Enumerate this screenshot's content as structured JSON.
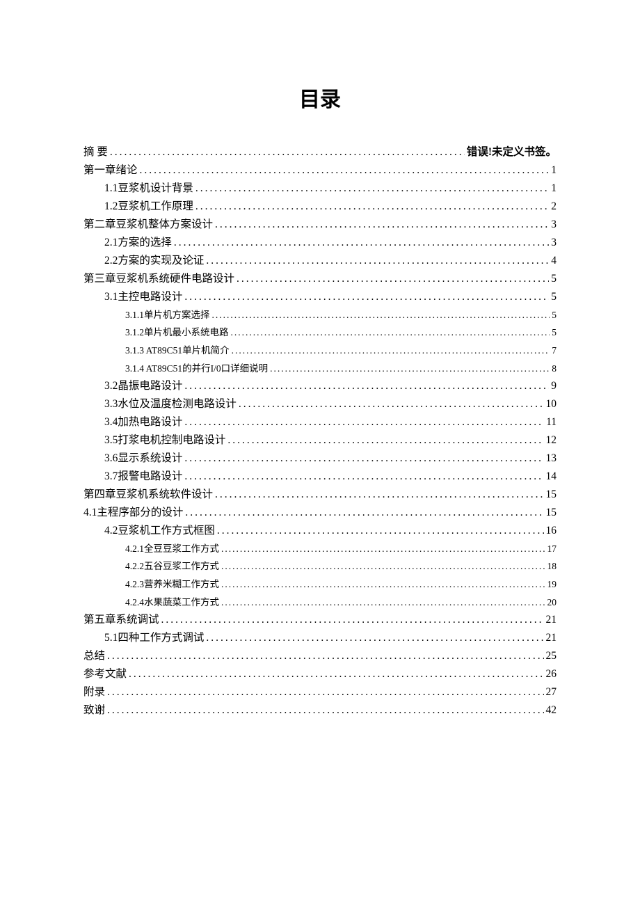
{
  "title": "目录",
  "entries": [
    {
      "label": "摘 要",
      "page": "错误!未定义书签。",
      "indent": 0,
      "size": "n",
      "errPage": true
    },
    {
      "label": "第一章绪论",
      "page": "1",
      "indent": 0,
      "size": "n"
    },
    {
      "label": "1.1豆浆机设计背景",
      "page": "1",
      "indent": 1,
      "size": "n"
    },
    {
      "label": "1.2豆浆机工作原理",
      "page": "2",
      "indent": 1,
      "size": "n"
    },
    {
      "label": "第二章豆浆机整体方案设计",
      "page": "3",
      "indent": 0,
      "size": "n"
    },
    {
      "label": "2.1方案的选择",
      "page": "3",
      "indent": 1,
      "size": "n"
    },
    {
      "label": "2.2方案的实现及论证",
      "page": "4",
      "indent": 1,
      "size": "n"
    },
    {
      "label": "第三章豆浆机系统硬件电路设计",
      "page": "5",
      "indent": 0,
      "size": "n"
    },
    {
      "label": "3.1主控电路设计",
      "page": "5",
      "indent": 1,
      "size": "n"
    },
    {
      "label": "3.1.1单片机方案选择",
      "page": "5",
      "indent": 2,
      "size": "s"
    },
    {
      "label": "3.1.2单片机最小系统电路",
      "page": "5",
      "indent": 2,
      "size": "s"
    },
    {
      "label": "3.1.3 AT89C51单片机简介",
      "page": "7",
      "indent": 2,
      "size": "s"
    },
    {
      "label": "3.1.4 AT89C51的并行I/0口详细说明",
      "page": "8",
      "indent": 2,
      "size": "s"
    },
    {
      "label": "3.2晶振电路设计",
      "page": "9",
      "indent": 1,
      "size": "n"
    },
    {
      "label": "3.3水位及温度检测电路设计",
      "page": "10",
      "indent": 1,
      "size": "n"
    },
    {
      "label": "3.4加热电路设计",
      "page": "11",
      "indent": 1,
      "size": "n"
    },
    {
      "label": "3.5打浆电机控制电路设计",
      "page": "12",
      "indent": 1,
      "size": "n"
    },
    {
      "label": "3.6显示系统设计",
      "page": "13",
      "indent": 1,
      "size": "n"
    },
    {
      "label": "3.7报警电路设计",
      "page": "14",
      "indent": 1,
      "size": "n"
    },
    {
      "label": "第四章豆浆机系统软件设计",
      "page": "15",
      "indent": 0,
      "size": "n"
    },
    {
      "label": "4.1主程序部分的设计",
      "page": "15",
      "indent": 0,
      "size": "n"
    },
    {
      "label": "4.2豆浆机工作方式框图",
      "page": "16",
      "indent": 1,
      "size": "n"
    },
    {
      "label": "4.2.1全豆豆浆工作方式",
      "page": "17",
      "indent": 2,
      "size": "s"
    },
    {
      "label": "4.2.2五谷豆浆工作方式",
      "page": "18",
      "indent": 2,
      "size": "s"
    },
    {
      "label": "4.2.3营养米糊工作方式",
      "page": "19",
      "indent": 2,
      "size": "s"
    },
    {
      "label": "4.2.4水果蔬菜工作方式",
      "page": "20",
      "indent": 2,
      "size": "s"
    },
    {
      "label": "第五章系统调试",
      "page": "21",
      "indent": 0,
      "size": "n"
    },
    {
      "label": "5.1四种工作方式调试",
      "page": "21",
      "indent": 1,
      "size": "n"
    },
    {
      "label": "总结",
      "page": "25",
      "indent": 0,
      "size": "n"
    },
    {
      "label": "参考文献",
      "page": "26",
      "indent": 0,
      "size": "n"
    },
    {
      "label": "附录",
      "page": "27",
      "indent": 0,
      "size": "n"
    },
    {
      "label": "致谢",
      "page": "42",
      "indent": 0,
      "size": "n"
    }
  ]
}
